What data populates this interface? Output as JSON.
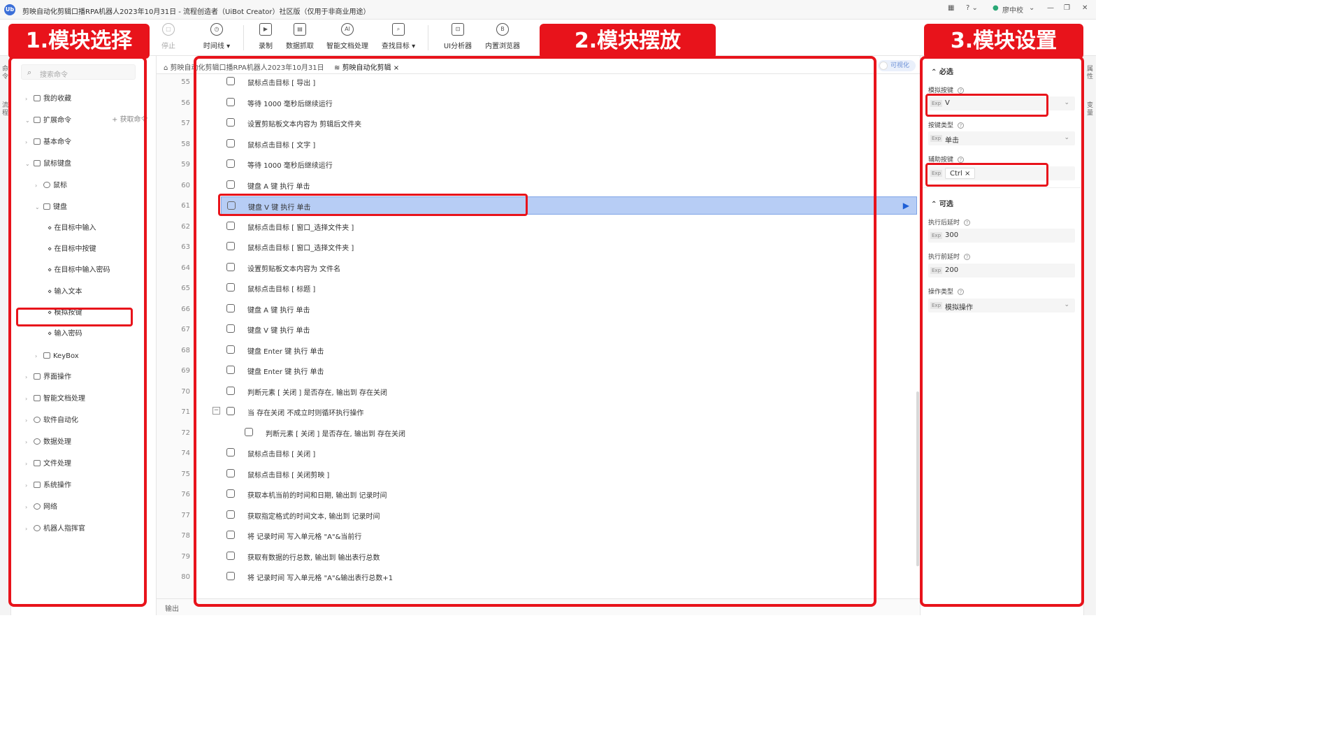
{
  "window": {
    "title": "剪映自动化剪辑口播RPA机器人2023年10月31日 - 流程创造者（UiBot Creator）社区版（仅用于非商业用途）",
    "logo": "Ub",
    "user": "廖中校"
  },
  "toolbar": [
    {
      "label": "停止",
      "icon": "stop-icon"
    },
    {
      "label": "时间线 ▾",
      "icon": "clock-icon"
    },
    {
      "label": "录制",
      "icon": "record-icon"
    },
    {
      "label": "数据抓取",
      "icon": "data-scrape-icon"
    },
    {
      "label": "智能文档处理",
      "icon": "ai-doc-icon"
    },
    {
      "label": "查找目标 ▾",
      "icon": "find-target-icon"
    },
    {
      "label": "UI分析器",
      "icon": "ui-analyzer-icon"
    },
    {
      "label": "内置浏览器",
      "icon": "browser-icon"
    }
  ],
  "left_strip": {
    "top": "命令",
    "bottom": "流程"
  },
  "right_strip": {
    "top": "属性",
    "bottom": "变量"
  },
  "sidebar": {
    "search_placeholder": "搜索命令",
    "fetch_label": "获取命令",
    "tree": [
      {
        "label": "我的收藏",
        "level": 0,
        "arrow": "›"
      },
      {
        "label": "扩展命令",
        "level": 0,
        "arrow": "⌄"
      },
      {
        "label": "基本命令",
        "level": 0,
        "arrow": "›"
      },
      {
        "label": "鼠标键盘",
        "level": 0,
        "arrow": "⌄"
      },
      {
        "label": "鼠标",
        "level": 1,
        "arrow": "›"
      },
      {
        "label": "键盘",
        "level": 1,
        "arrow": "⌄"
      },
      {
        "label": "在目标中输入",
        "level": 2,
        "arrow": ""
      },
      {
        "label": "在目标中按键",
        "level": 2,
        "arrow": ""
      },
      {
        "label": "在目标中输入密码",
        "level": 2,
        "arrow": ""
      },
      {
        "label": "输入文本",
        "level": 2,
        "arrow": ""
      },
      {
        "label": "模拟按键",
        "level": 2,
        "arrow": ""
      },
      {
        "label": "输入密码",
        "level": 2,
        "arrow": ""
      },
      {
        "label": "KeyBox",
        "level": 1,
        "arrow": "›"
      },
      {
        "label": "界面操作",
        "level": 0,
        "arrow": "›"
      },
      {
        "label": "智能文档处理",
        "level": 0,
        "arrow": "›"
      },
      {
        "label": "软件自动化",
        "level": 0,
        "arrow": "›"
      },
      {
        "label": "数据处理",
        "level": 0,
        "arrow": "›"
      },
      {
        "label": "文件处理",
        "level": 0,
        "arrow": "›"
      },
      {
        "label": "系统操作",
        "level": 0,
        "arrow": "›"
      },
      {
        "label": "网络",
        "level": 0,
        "arrow": "›"
      },
      {
        "label": "机器人指挥官",
        "level": 0,
        "arrow": "›"
      }
    ]
  },
  "tabs": [
    {
      "label": "剪映自动化剪辑口播RPA机器人2023年10月31日"
    },
    {
      "label": "剪映自动化剪辑 ×"
    }
  ],
  "visualize_label": "可视化",
  "code_rows": [
    {
      "line": "55",
      "text": "鼠标点击目标 [ 导出  ]"
    },
    {
      "line": "56",
      "text": "等待 1000 毫秒后继续运行"
    },
    {
      "line": "57",
      "text": "设置剪贴板文本内容为 剪辑后文件夹"
    },
    {
      "line": "58",
      "text": "鼠标点击目标 [ 文字  ]"
    },
    {
      "line": "59",
      "text": "等待 1000 毫秒后继续运行"
    },
    {
      "line": "60",
      "text": "键盘 A 键 执行 单击"
    },
    {
      "line": "61",
      "text": "键盘 V 键 执行 单击"
    },
    {
      "line": "62",
      "text": "鼠标点击目标 [ 窗口_选择文件夹  ]"
    },
    {
      "line": "63",
      "text": "鼠标点击目标 [ 窗口_选择文件夹  ]"
    },
    {
      "line": "64",
      "text": "设置剪贴板文本内容为 文件名"
    },
    {
      "line": "65",
      "text": "鼠标点击目标 [ 标题  ]"
    },
    {
      "line": "66",
      "text": "键盘 A 键 执行 单击"
    },
    {
      "line": "67",
      "text": "键盘 V 键 执行 单击"
    },
    {
      "line": "68",
      "text": "键盘 Enter 键 执行 单击"
    },
    {
      "line": "69",
      "text": "键盘 Enter 键 执行 单击"
    },
    {
      "line": "70",
      "text": "判断元素 [ 关闭  ] 是否存在, 输出到 存在关闭"
    },
    {
      "line": "71",
      "text": "当 存在关闭 不成立时则循环执行操作"
    },
    {
      "line": "72",
      "text": "判断元素 [ 关闭  ] 是否存在, 输出到 存在关闭"
    },
    {
      "line": "74",
      "text": "鼠标点击目标 [ 关闭  ]"
    },
    {
      "line": "75",
      "text": "鼠标点击目标 [ 关闭剪映  ]"
    },
    {
      "line": "76",
      "text": "获取本机当前的时间和日期, 输出到 记录时间"
    },
    {
      "line": "77",
      "text": "获取指定格式的时间文本, 输出到 记录时间"
    },
    {
      "line": "78",
      "text": "将 记录时间 写入单元格 \"A\"&当前行"
    },
    {
      "line": "79",
      "text": "获取有数据的行总数, 输出到 输出表行总数"
    },
    {
      "line": "80",
      "text": "将 记录时间 写入单元格 \"A\"&输出表行总数+1"
    }
  ],
  "output_label": "输出",
  "props": {
    "required_label": "必选",
    "optional_label": "可选",
    "fields": [
      {
        "label": "模拟按键",
        "value": "V",
        "type": "select"
      },
      {
        "label": "按键类型",
        "value": "单击",
        "type": "select"
      },
      {
        "label": "辅助按键",
        "value": "Ctrl ×",
        "type": "chip"
      },
      {
        "label": "执行后延时",
        "value": "300",
        "type": "input"
      },
      {
        "label": "执行前延时",
        "value": "200",
        "type": "input"
      },
      {
        "label": "操作类型",
        "value": "模拟操作",
        "type": "select"
      }
    ],
    "exp_tag": "Exp"
  },
  "annotations": {
    "banner1": "1.模块选择",
    "banner2": "2.模块摆放",
    "banner3": "3.模块设置",
    "color": "#e8131b"
  },
  "colors": {
    "accent": "#1f5fd6",
    "highlight_row": "#b7cdf5"
  }
}
